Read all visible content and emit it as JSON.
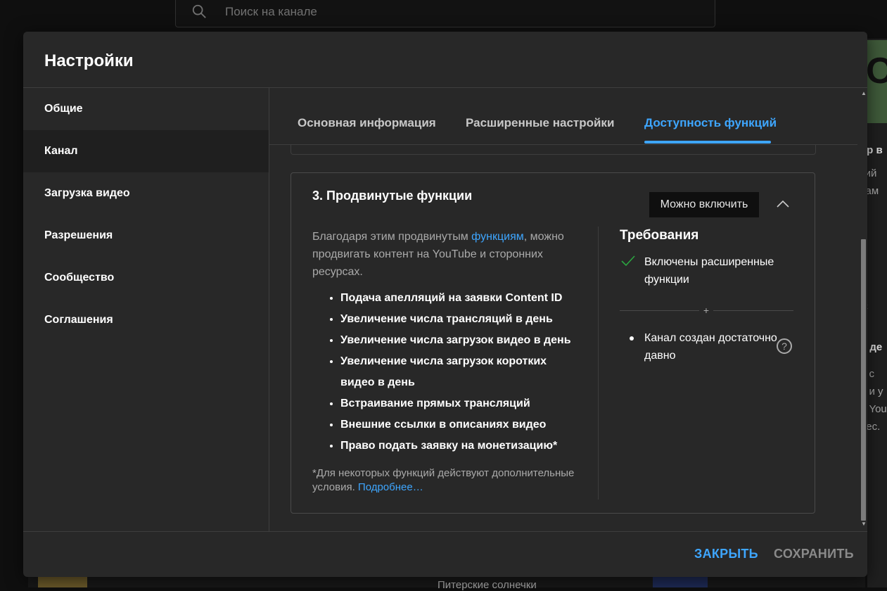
{
  "background": {
    "search_placeholder": "Поиск на канале",
    "right_fragments": [
      "ор в",
      "кий",
      "сам",
      "С",
      "р де",
      "о с",
      "а и у",
      "н You",
      "нес."
    ],
    "bottom_text": "Питерские солнечки"
  },
  "dialog": {
    "title": "Настройки",
    "sidebar": [
      {
        "label": "Общие",
        "active": false
      },
      {
        "label": "Канал",
        "active": true
      },
      {
        "label": "Загрузка видео",
        "active": false
      },
      {
        "label": "Разрешения",
        "active": false
      },
      {
        "label": "Сообщество",
        "active": false
      },
      {
        "label": "Соглашения",
        "active": false
      }
    ],
    "tabs": [
      {
        "label": "Основная информация",
        "active": false
      },
      {
        "label": "Расширенные настройки",
        "active": false
      },
      {
        "label": "Доступность функций",
        "active": true
      }
    ],
    "card": {
      "title": "3. Продвинутые функции",
      "badge": "Можно включить",
      "intro_before": "Благодаря этим продвинутым ",
      "intro_link": "функциям",
      "intro_after": ", можно продвигать контент на YouTube и сторонних ресурсах.",
      "features": [
        "Подача апелляций на заявки Content ID",
        "Увеличение числа трансляций в день",
        "Увеличение числа загрузок видео в день",
        "Увеличение числа загрузок коротких видео в день",
        "Встраивание прямых трансляций",
        "Внешние ссылки в описаниях видео",
        "Право подать заявку на монетизацию*"
      ],
      "note_text": "*Для некоторых функций действуют дополнительные условия.",
      "note_link": "Подробнее…",
      "requirements": {
        "title": "Требования",
        "item_met": "Включены расширенные функции",
        "separator": "+",
        "item_pending": "Канал создан достаточно давно",
        "help": "?"
      }
    },
    "buttons": {
      "close": "ЗАКРЫТЬ",
      "save": "СОХРАНИТЬ"
    },
    "colors": {
      "accent": "#3ea6ff",
      "check": "#2ba640",
      "dialog_bg": "#282828"
    }
  }
}
